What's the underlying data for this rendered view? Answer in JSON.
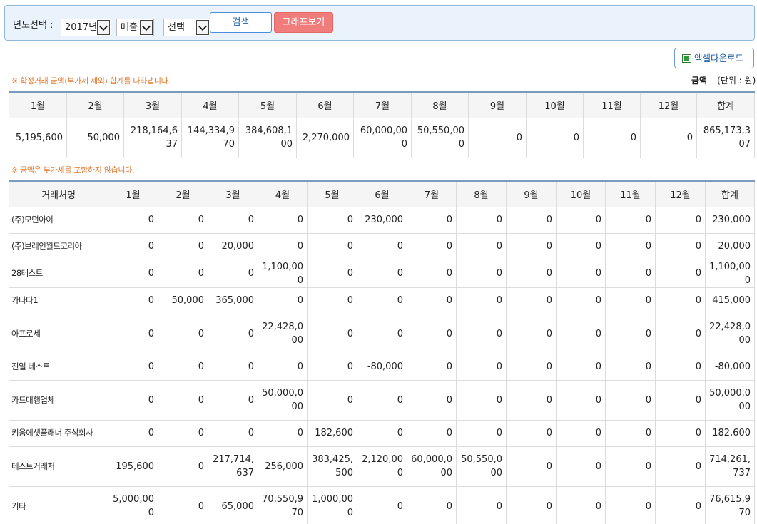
{
  "filter": {
    "year_label": "년도선택 :",
    "year_value": "2017년",
    "type_value": "매출",
    "select_value": "선택",
    "search_label": "검색",
    "graph_label": "그래프보기"
  },
  "excel_label": "엑셀다운로드",
  "notes": {
    "summary": "※ 확정거래 금액(부가세 제외) 합계를 나타냅니다.",
    "detail": "※ 금액은 부가세를 포함하지 않습니다."
  },
  "unit": {
    "label": "금액",
    "text": "(단위 : 원)"
  },
  "colors": {
    "accent": "#4a90d9",
    "graph_button": "#f07c7c",
    "note": "#e07a30",
    "header_bg": "#f5f5f5"
  },
  "summary": {
    "headers": [
      "1월",
      "2월",
      "3월",
      "4월",
      "5월",
      "6월",
      "7월",
      "8월",
      "9월",
      "10월",
      "11월",
      "12월",
      "합계"
    ],
    "values": [
      "5,195,600",
      "50,000",
      "218,164,637",
      "144,334,970",
      "384,608,100",
      "2,270,000",
      "60,000,000",
      "50,550,000",
      "0",
      "0",
      "0",
      "0",
      "865,173,307"
    ]
  },
  "detail": {
    "headers": [
      "거래처명",
      "1월",
      "2월",
      "3월",
      "4월",
      "5월",
      "6월",
      "7월",
      "8월",
      "9월",
      "10월",
      "11월",
      "12월",
      "합계"
    ],
    "rows": [
      {
        "name": "(주)모던아이",
        "values": [
          "0",
          "0",
          "0",
          "0",
          "0",
          "230,000",
          "0",
          "0",
          "0",
          "0",
          "0",
          "0",
          "230,000"
        ]
      },
      {
        "name": "(주)브레인월드코리아",
        "values": [
          "0",
          "0",
          "20,000",
          "0",
          "0",
          "0",
          "0",
          "0",
          "0",
          "0",
          "0",
          "0",
          "20,000"
        ]
      },
      {
        "name": "28테스트",
        "values": [
          "0",
          "0",
          "0",
          "1,100,000",
          "0",
          "0",
          "0",
          "0",
          "0",
          "0",
          "0",
          "0",
          "1,100,000"
        ]
      },
      {
        "name": "가나다1",
        "values": [
          "0",
          "50,000",
          "365,000",
          "0",
          "0",
          "0",
          "0",
          "0",
          "0",
          "0",
          "0",
          "0",
          "415,000"
        ]
      },
      {
        "name": "아프로세",
        "values": [
          "0",
          "0",
          "0",
          "22,428,000",
          "0",
          "0",
          "0",
          "0",
          "0",
          "0",
          "0",
          "0",
          "22,428,000"
        ]
      },
      {
        "name": "진일 테스트",
        "values": [
          "0",
          "0",
          "0",
          "0",
          "0",
          "-80,000",
          "0",
          "0",
          "0",
          "0",
          "0",
          "0",
          "-80,000"
        ]
      },
      {
        "name": "카드대행업체",
        "values": [
          "0",
          "0",
          "0",
          "50,000,000",
          "0",
          "0",
          "0",
          "0",
          "0",
          "0",
          "0",
          "0",
          "50,000,000"
        ]
      },
      {
        "name": "키움에셋플래너 주식회사",
        "values": [
          "0",
          "0",
          "0",
          "0",
          "182,600",
          "0",
          "0",
          "0",
          "0",
          "0",
          "0",
          "0",
          "182,600"
        ]
      },
      {
        "name": "테스트거래처",
        "values": [
          "195,600",
          "0",
          "217,714,637",
          "256,000",
          "383,425,500",
          "2,120,000",
          "60,000,000",
          "50,550,000",
          "0",
          "0",
          "0",
          "0",
          "714,261,737"
        ]
      },
      {
        "name": "기타",
        "values": [
          "5,000,000",
          "0",
          "65,000",
          "70,550,970",
          "1,000,000",
          "0",
          "0",
          "0",
          "0",
          "0",
          "0",
          "0",
          "76,615,970"
        ]
      }
    ]
  }
}
